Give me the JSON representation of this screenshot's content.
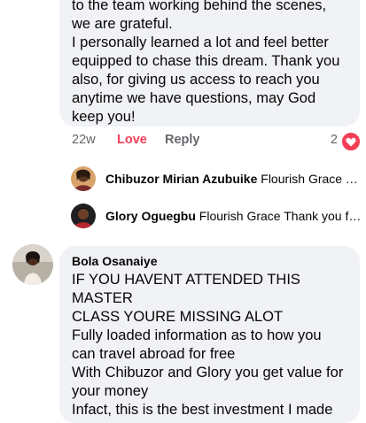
{
  "comment1": {
    "text": "to the team working behind the scenes,\nwe are grateful.\nI personally learned a lot and feel better\nequipped to chase this dream. Thank you\nalso, for giving us access to reach you\nanytime we have questions, may God\nkeep you!",
    "time": "22w",
    "love_label": "Love",
    "reply_label": "Reply",
    "reaction_count": "2",
    "reaction_icon": "heart-icon",
    "accent_color": "#f33e58"
  },
  "replies": [
    {
      "name": "Chibuzor Mirian Azubuike",
      "snippet": "Flourish Grace Th..."
    },
    {
      "name": "Glory Oguegbu",
      "snippet": "Flourish Grace Thank you for..."
    }
  ],
  "comment2": {
    "author": "Bola Osanaiye",
    "text": "IF YOU HAVENT ATTENDED THIS MASTER\nCLASS YOURE MISSING ALOT\nFully loaded information as to how you\ncan travel abroad for free\nWith Chibuzor and Glory you get value for\nyour money\nInfact, this is the best investment I made"
  }
}
